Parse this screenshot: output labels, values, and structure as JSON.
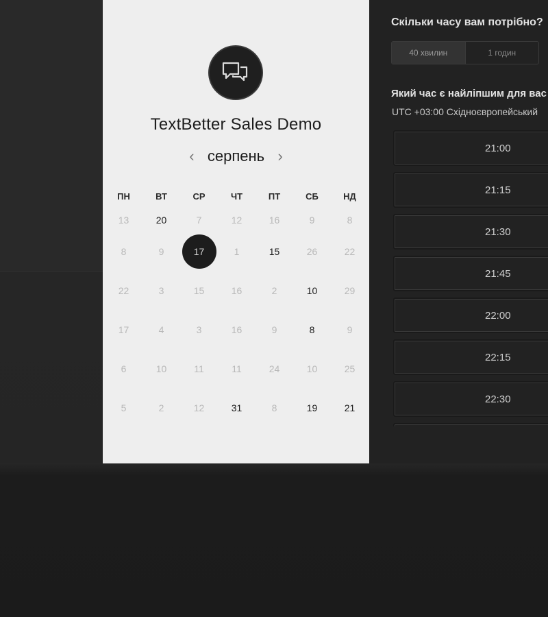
{
  "title": "TextBetter Sales Demo",
  "calendar": {
    "month": "серпень",
    "prev_icon": "chevron-left-icon",
    "next_icon": "chevron-right-icon",
    "weekdays": [
      "ПН",
      "ВТ",
      "СР",
      "ЧТ",
      "ПТ",
      "СБ",
      "НД"
    ],
    "weeks": [
      [
        "13",
        "20",
        "7",
        "12",
        "16",
        "9",
        "8"
      ],
      [
        "8",
        "9",
        "17",
        "1",
        "15",
        "26",
        "22"
      ],
      [
        "22",
        "3",
        "15",
        "16",
        "2",
        "10",
        "29"
      ],
      [
        "17",
        "4",
        "3",
        "16",
        "9",
        "8",
        "9"
      ],
      [
        "6",
        "10",
        "11",
        "11",
        "24",
        "10",
        "25"
      ],
      [
        "5",
        "2",
        "12",
        "31",
        "8",
        "19",
        "21"
      ]
    ],
    "available": [
      [
        false,
        true,
        false,
        false,
        false,
        false,
        false
      ],
      [
        false,
        false,
        false,
        false,
        true,
        false,
        false
      ],
      [
        false,
        false,
        false,
        false,
        false,
        true,
        false
      ],
      [
        false,
        false,
        false,
        false,
        false,
        true,
        false
      ],
      [
        false,
        false,
        false,
        false,
        false,
        false,
        false
      ],
      [
        false,
        false,
        false,
        true,
        false,
        true,
        true
      ]
    ],
    "selected": {
      "week": 1,
      "day": 2
    }
  },
  "duration": {
    "question": "Скільки часу вам потрібно?",
    "options": [
      "40 хвилин",
      "1 годин"
    ],
    "active_index": 0
  },
  "time": {
    "question": "Який час є найліпшим для вас",
    "timezone": "UTC +03:00 Східноєвропейський",
    "slots": [
      "21:00",
      "21:15",
      "21:30",
      "21:45",
      "22:00",
      "22:15",
      "22:30",
      ""
    ]
  },
  "colors": {
    "panel_light": "#eeeeee",
    "panel_dark": "#222222",
    "selected_day": "#1d1d1d"
  },
  "logo_icon": "chat-bubbles-icon"
}
